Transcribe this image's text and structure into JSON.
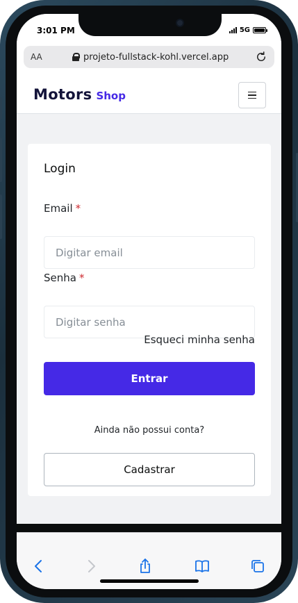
{
  "status_bar": {
    "time": "3:01 PM",
    "network": "5G"
  },
  "browser": {
    "aa_label": "AA",
    "url": "projeto-fullstack-kohl.vercel.app"
  },
  "header": {
    "brand_main": "Motors",
    "brand_sub": "Shop"
  },
  "login": {
    "title": "Login",
    "email_label": "Email",
    "email_placeholder": "Digitar email",
    "email_value": "",
    "password_label": "Senha",
    "password_placeholder": "Digitar senha",
    "password_value": "",
    "required_mark": "*",
    "forgot_link": "Esqueci minha senha",
    "submit_label": "Entrar",
    "no_account_text": "Ainda não possui conta?",
    "register_label": "Cadastrar"
  },
  "icons": [
    "signal-icon",
    "battery-icon",
    "lock-icon",
    "reload-icon",
    "hamburger-menu-icon",
    "back-chevron-icon",
    "forward-chevron-icon",
    "share-icon",
    "bookmarks-icon",
    "tabs-icon"
  ],
  "colors": {
    "brand_dark": "#14143a",
    "brand_accent": "#4529e6",
    "required": "#cd2b31",
    "page_bg": "#f1f2f4"
  }
}
